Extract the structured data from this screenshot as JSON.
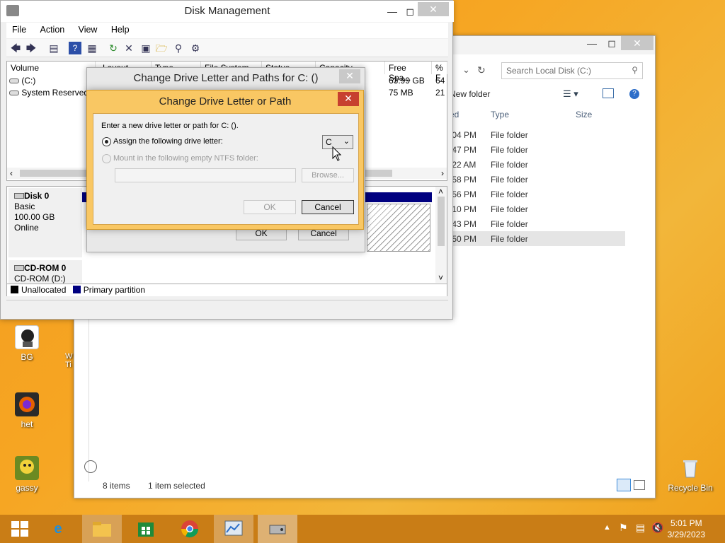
{
  "desktop": {
    "icons": [
      {
        "label": "BG"
      },
      {
        "label": "het"
      },
      {
        "label": "gassy"
      },
      {
        "label": "Recycle Bin"
      }
    ]
  },
  "explorer": {
    "search_placeholder": "Search Local Disk (C:)",
    "new_folder": "New folder",
    "columns": {
      "modified": "ed",
      "type": "Type",
      "size": "Size"
    },
    "rows": [
      {
        "time": ":04 PM",
        "type": "File folder"
      },
      {
        "time": ":47 PM",
        "type": "File folder"
      },
      {
        "time": ":22 AM",
        "type": "File folder"
      },
      {
        "time": ":58 PM",
        "type": "File folder"
      },
      {
        "time": ":56 PM",
        "type": "File folder"
      },
      {
        "time": ":10 PM",
        "type": "File folder"
      },
      {
        "time": ":43 PM",
        "type": "File folder"
      },
      {
        "time": ":50 PM",
        "type": "File folder"
      }
    ],
    "status_items": "8 items",
    "status_selected": "1 item selected"
  },
  "disk_mgmt": {
    "title": "Disk Management",
    "menu": [
      "File",
      "Action",
      "View",
      "Help"
    ],
    "columns": [
      "Volume",
      "Layout",
      "Type",
      "File System",
      "Status",
      "Capacity",
      "Free Spa...",
      "% F"
    ],
    "volumes": [
      {
        "name": "(C:)",
        "free": "63.99 GB",
        "pct": "64"
      },
      {
        "name": "System Reserved",
        "free": "75 MB",
        "pct": "21"
      }
    ],
    "disk0": {
      "name": "Disk 0",
      "type": "Basic",
      "size": "100.00 GB",
      "status": "Online"
    },
    "cdrom": {
      "name": "CD-ROM 0",
      "drive": "CD-ROM (D:)"
    },
    "legend": {
      "unallocated": "Unallocated",
      "primary": "Primary partition"
    }
  },
  "dialog_back": {
    "title": "Change Drive Letter and Paths for C: ()",
    "ok": "OK",
    "cancel": "Cancel"
  },
  "dialog_front": {
    "title": "Change Drive Letter or Path",
    "prompt": "Enter a new drive letter or path for C: ().",
    "assign_label": "Assign the following drive letter:",
    "drive_letter": "C",
    "mount_label": "Mount in the following empty NTFS folder:",
    "browse": "Browse...",
    "ok": "OK",
    "cancel": "Cancel"
  },
  "taskbar": {
    "time": "5:01 PM",
    "date": "3/29/2023"
  },
  "colors": {
    "accent": "#f9c763",
    "primary_partition": "#000080",
    "taskbar": "#c97d16"
  }
}
